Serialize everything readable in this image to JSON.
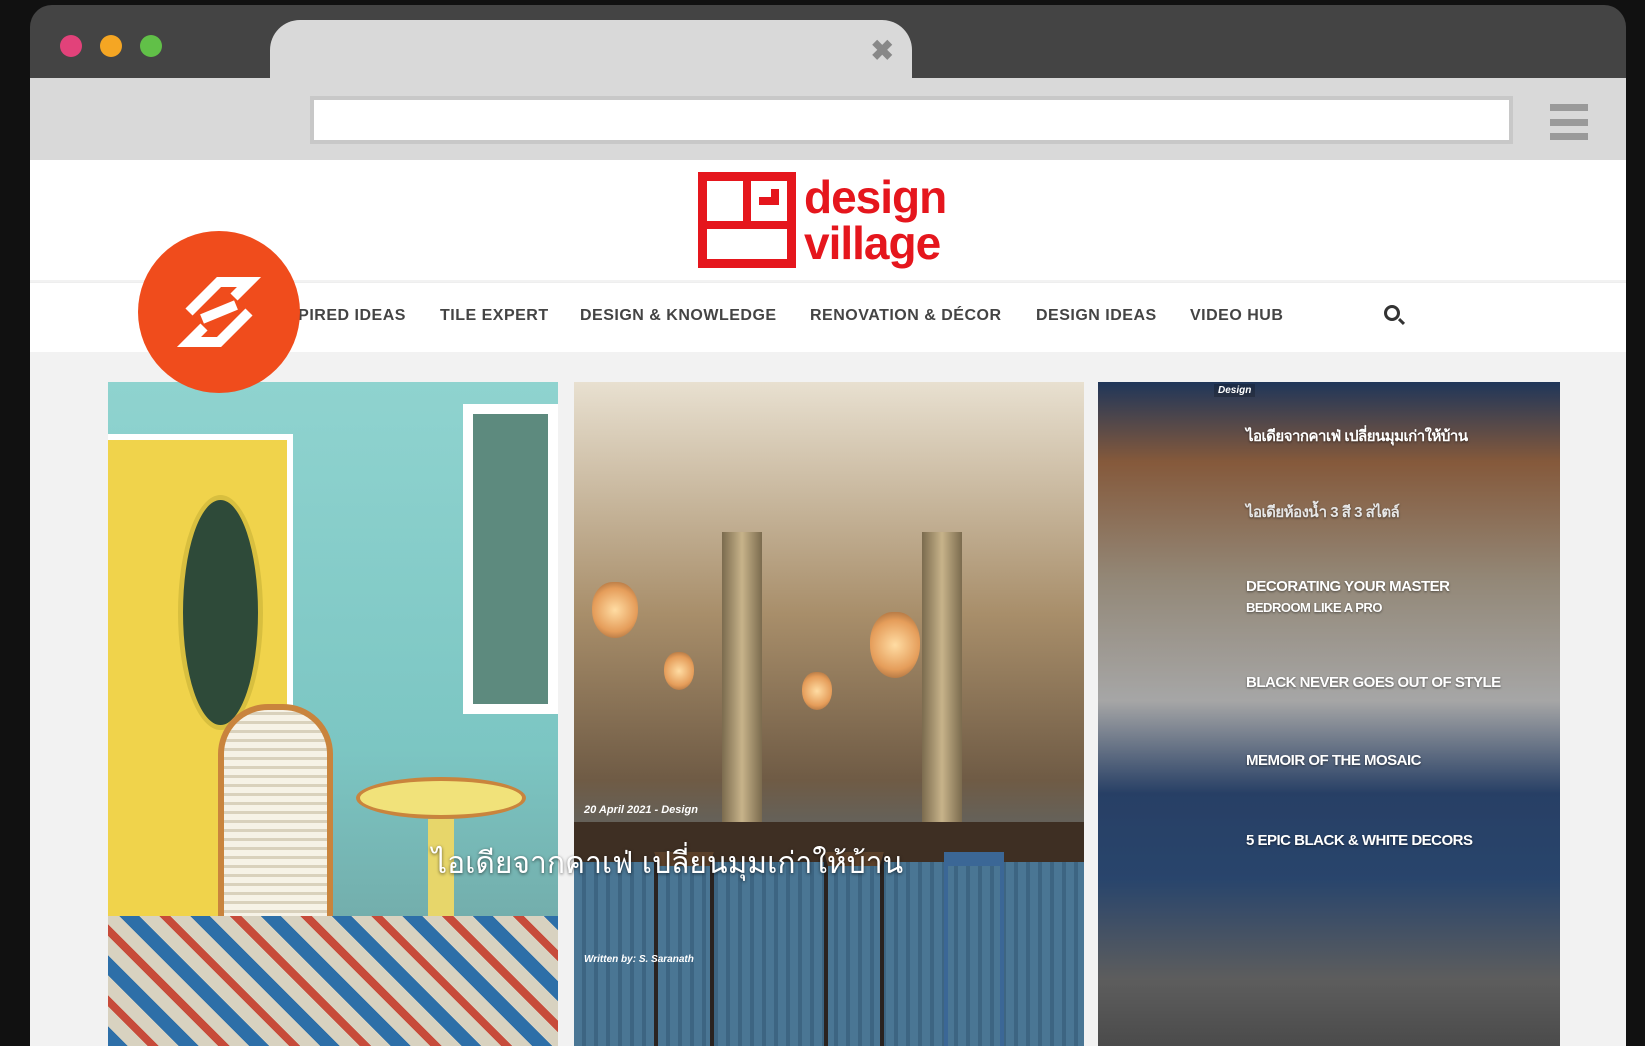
{
  "browser": {
    "tab_close": "✖"
  },
  "site": {
    "logo_line1": "design",
    "logo_line2": "village"
  },
  "nav": {
    "items": [
      "SPIRED IDEAS",
      "TILE EXPERT",
      "DESIGN & KNOWLEDGE",
      "RENOVATION & DÉCOR",
      "DESIGN IDEAS",
      "VIDEO HUB"
    ]
  },
  "featured": {
    "meta": "20 April 2021 - Design",
    "headline": "ไอเดียจากคาเฟ่ เปลี่ยนมุมเก่าให้บ้าน",
    "byline": "Written by: S. Saranath"
  },
  "sidebar": {
    "category": "Design",
    "items": [
      "ไอเดียจากคาเฟ่ เปลี่ยนมุมเก่าให้บ้าน",
      "ไอเดียห้องน้ำ 3 สี 3 สไตล์",
      "DECORATING YOUR MASTER",
      "BEDROOM LIKE A PRO",
      "BLACK NEVER GOES OUT OF STYLE",
      "MEMOIR OF THE MOSAIC",
      "5 EPIC BLACK & WHITE DECORS"
    ]
  },
  "icons": {
    "brand_badge": "stripes-logo-icon",
    "search": "search-icon"
  },
  "colors": {
    "brand_red": "#e5161d",
    "badge_orange": "#f04c1c"
  }
}
